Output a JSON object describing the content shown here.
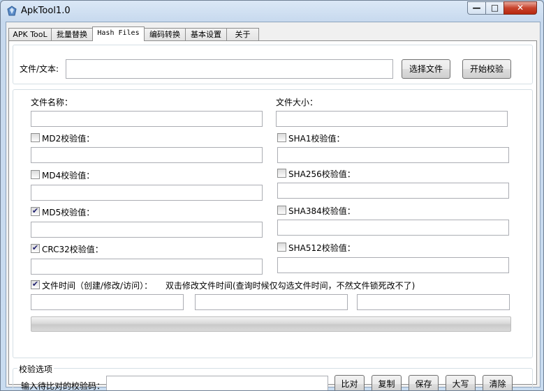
{
  "window": {
    "title": "ApkTool1.0",
    "min_glyph": "—",
    "max_glyph": "□",
    "close_glyph": "✕"
  },
  "tabs": [
    {
      "label": "APK TooL"
    },
    {
      "label": "批量替换"
    },
    {
      "label": "Hash Files"
    },
    {
      "label": "编码转换"
    },
    {
      "label": "基本设置"
    },
    {
      "label": "关于"
    }
  ],
  "file_row": {
    "label": "文件/文本:",
    "value": "",
    "choose_button": "选择文件",
    "start_button": "开始校验"
  },
  "info": {
    "file_name_label": "文件名称：",
    "file_name_value": "",
    "file_size_label": "文件大小：",
    "file_size_value": ""
  },
  "hashes_left": [
    {
      "label": "MD2校验值：",
      "checked": false,
      "value": ""
    },
    {
      "label": "MD4校验值：",
      "checked": false,
      "value": ""
    },
    {
      "label": "MD5校验值：",
      "checked": true,
      "value": ""
    },
    {
      "label": "CRC32校验值：",
      "checked": true,
      "value": ""
    }
  ],
  "hashes_right": [
    {
      "label": "SHA1校验值：",
      "checked": false,
      "value": ""
    },
    {
      "label": "SHA256校验值：",
      "checked": false,
      "value": ""
    },
    {
      "label": "SHA384校验值：",
      "checked": false,
      "value": ""
    },
    {
      "label": "SHA512校验值：",
      "checked": false,
      "value": ""
    }
  ],
  "file_time": {
    "label": "文件时间（创建/修改/访问）：",
    "checked": true,
    "hint": "双击修改文件时间(查询时候仅勾选文件时间，不然文件锁死改不了)",
    "created": "",
    "modified": "",
    "accessed": ""
  },
  "progress": {
    "value": 0
  },
  "verify": {
    "group_title": "校验选项",
    "input_label": "输入待比对的校验码：",
    "input_value": "",
    "buttons": {
      "compare": "比对",
      "copy": "复制",
      "save": "保存",
      "upper": "大写",
      "clear": "清除"
    }
  },
  "colors": {
    "titlebar": "#c9dcf0",
    "close": "#c7432c",
    "check": "#1e1e6e"
  }
}
